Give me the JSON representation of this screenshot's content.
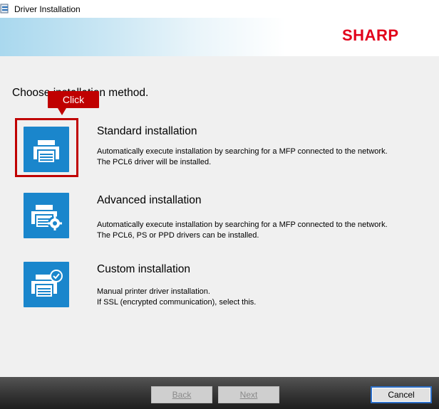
{
  "window": {
    "title": "Driver Installation"
  },
  "brand": {
    "logo_text": "SHARP",
    "logo_color": "#e2001a"
  },
  "heading": "Choose installation method.",
  "callout": {
    "label": "Click",
    "color": "#c00000"
  },
  "options": [
    {
      "title": "Standard installation",
      "desc_line1": "Automatically execute installation by searching for a MFP connected to the network.",
      "desc_line2": "The PCL6 driver will be installed.",
      "icon": "printer-icon"
    },
    {
      "title": "Advanced installation",
      "desc_line1": "Automatically execute installation by searching for a MFP connected to the network.",
      "desc_line2": "The PCL6, PS or PPD drivers can be installed.",
      "icon": "printer-gear-icon"
    },
    {
      "title": "Custom installation",
      "desc_line1": "Manual printer driver installation.",
      "desc_line2": "If SSL (encrypted communication), select this.",
      "icon": "printer-check-icon"
    }
  ],
  "footer": {
    "back_label": "Back",
    "next_label": "Next",
    "cancel_label": "Cancel"
  },
  "colors": {
    "icon_blue": "#1a86cc",
    "accent_red": "#c00000"
  }
}
